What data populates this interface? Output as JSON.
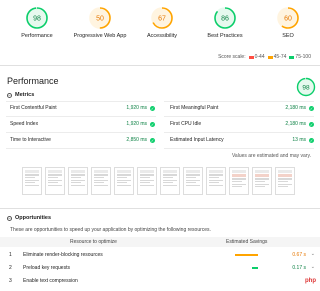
{
  "gauges": [
    {
      "score": "98",
      "label": "Performance",
      "color": "#0cce6b",
      "bg": "#e6f9ee",
      "text": "#0b8043",
      "fraction": 0.98
    },
    {
      "score": "50",
      "label": "Progressive Web App",
      "color": "#ffa400",
      "bg": "#fff4e0",
      "text": "#e67700",
      "fraction": 0.5
    },
    {
      "score": "67",
      "label": "Accessibility",
      "color": "#ffa400",
      "bg": "#fff4e0",
      "text": "#e67700",
      "fraction": 0.67
    },
    {
      "score": "86",
      "label": "Best Practices",
      "color": "#0cce6b",
      "bg": "#e6f9ee",
      "text": "#0b8043",
      "fraction": 0.86
    },
    {
      "score": "60",
      "label": "SEO",
      "color": "#ffa400",
      "bg": "#fff4e0",
      "text": "#e67700",
      "fraction": 0.6
    }
  ],
  "score_scale": {
    "label": "Score scale:",
    "ranges": [
      {
        "range": "0-44",
        "color": "#ff4e42"
      },
      {
        "range": "45-74",
        "color": "#ffa400"
      },
      {
        "range": "75-100",
        "color": "#0cce6b"
      }
    ]
  },
  "performance": {
    "title": "Performance",
    "score": "98",
    "fraction": 0.98
  },
  "metrics": {
    "heading": "Metrics",
    "items": [
      {
        "label": "First Contentful Paint",
        "value": "1,920 ms"
      },
      {
        "label": "First Meaningful Paint",
        "value": "2,180 ms"
      },
      {
        "label": "Speed Index",
        "value": "1,920 ms"
      },
      {
        "label": "First CPU Idle",
        "value": "2,180 ms"
      },
      {
        "label": "Time to Interactive",
        "value": "2,850 ms"
      },
      {
        "label": "Estimated Input Latency",
        "value": "13 ms"
      }
    ],
    "note": "Values are estimated and may vary."
  },
  "opportunities": {
    "heading": "Opportunities",
    "description": "These are opportunities to speed up your application by optimizing the following resources.",
    "col_resource": "Resource to optimize",
    "col_savings": "Estimated Savings",
    "items": [
      {
        "num": "1",
        "title": "Eliminate render-blocking resources",
        "savings": "0.67 s",
        "color": "#ffa400",
        "fraction": 0.67
      },
      {
        "num": "2",
        "title": "Preload key requests",
        "savings": "0.17 s",
        "color": "#0cce6b",
        "fraction": 0.17
      },
      {
        "num": "3",
        "title": "Enable text compression",
        "savings": "",
        "color": "#0cce6b",
        "fraction": 0
      }
    ]
  },
  "icons": {
    "check": "check-icon",
    "toggle": "collapse-toggle-icon",
    "chevron": "chevron-down-icon"
  },
  "watermark": "php中文网"
}
